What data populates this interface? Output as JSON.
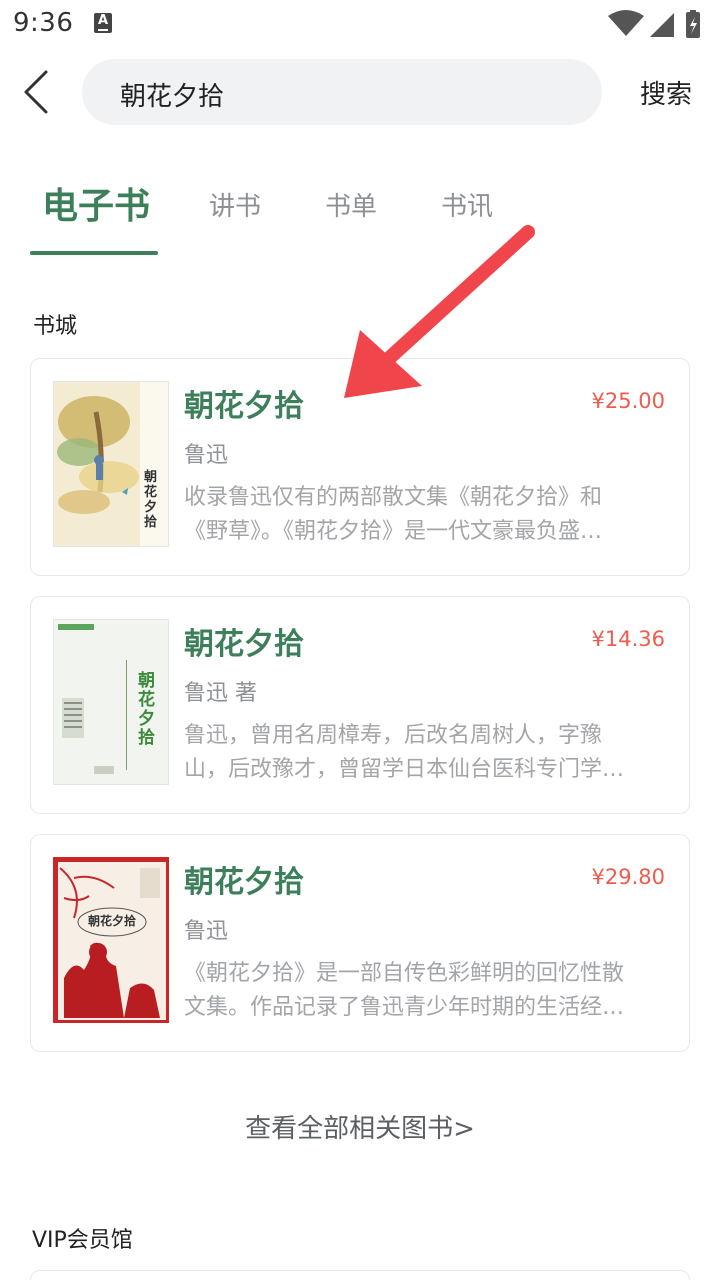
{
  "status_bar": {
    "time": "9:36",
    "notification_icon": "A"
  },
  "header": {
    "search_text": "朝花夕拾",
    "search_button": "搜索"
  },
  "tabs": [
    {
      "label": "电子书",
      "active": true
    },
    {
      "label": "讲书",
      "active": false
    },
    {
      "label": "书单",
      "active": false
    },
    {
      "label": "书讯",
      "active": false
    }
  ],
  "section_bookstore": "书城",
  "books": [
    {
      "title": "朝花夕拾",
      "price": "¥25.00",
      "author": "鲁迅",
      "desc_line1": "收录鲁迅仅有的两部散文集《朝花夕拾》和",
      "desc_line2": "《野草》。《朝花夕拾》是一代文豪最负盛…",
      "cover_text": "朝花夕拾"
    },
    {
      "title": "朝花夕拾",
      "price": "¥14.36",
      "author": "鲁迅 著",
      "desc_line1": "鲁迅，曾用名周樟寿，后改名周树人，字豫",
      "desc_line2": "山，后改豫才，曾留学日本仙台医科专门学…",
      "cover_text": "朝花夕拾"
    },
    {
      "title": "朝花夕拾",
      "price": "¥29.80",
      "author": "鲁迅",
      "desc_line1": "《朝花夕拾》是一部自传色彩鲜明的回忆性散",
      "desc_line2": "文集。作品记录了鲁迅青少年时期的生活经…",
      "cover_text": "朝花夕拾"
    }
  ],
  "view_all": "查看全部相关图书>",
  "section_vip": "VIP会员馆",
  "colors": {
    "accent": "#3e7f5b",
    "price": "#ef5b4c",
    "arrow": "#f0454a"
  }
}
